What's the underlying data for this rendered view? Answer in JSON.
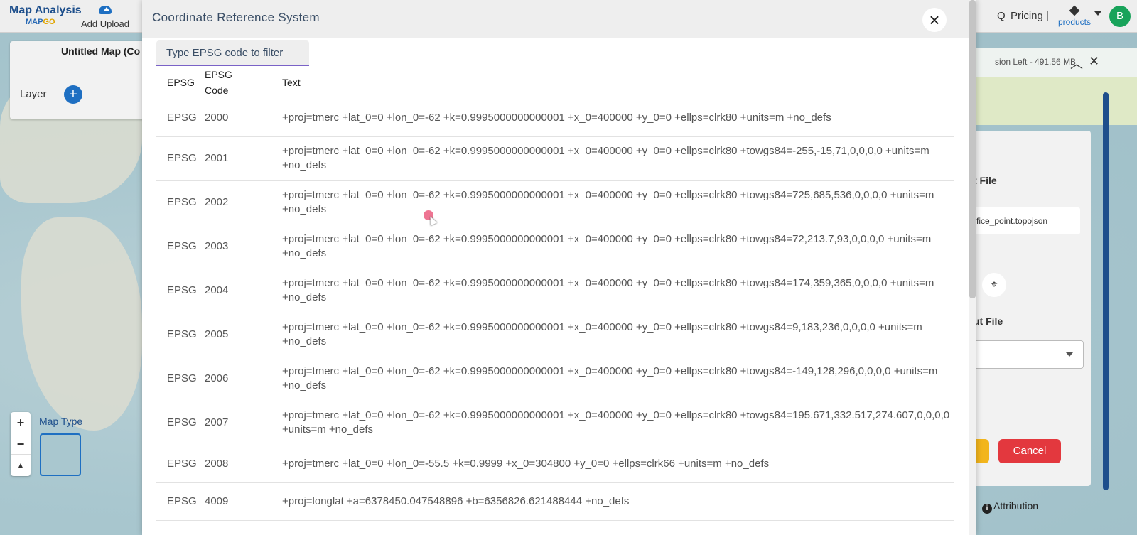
{
  "app": {
    "brand": "Map Analysis",
    "brand_sub_1": "MAP",
    "brand_sub_2": "GO",
    "add_upload": "Add Upload",
    "search_fragment": "Q",
    "pricing": "Pricing |",
    "products": "products",
    "avatar": "B"
  },
  "left_panel": {
    "map_title": "Untitled Map (Co",
    "layer_label": "Layer",
    "map_type_label": "Map Type"
  },
  "right_panel": {
    "session_text": "sion Left - 491.56 MB",
    "input_label": "t File",
    "file_name": "fice_point.topojson",
    "output_label": "ut File",
    "cancel": "Cancel",
    "attribution": "Attribution"
  },
  "modal": {
    "title": "Coordinate Reference System",
    "filter_placeholder": "Type EPSG code to filter",
    "columns": [
      "EPSG",
      "EPSG Code",
      "Text"
    ],
    "rows": [
      {
        "epsg": "EPSG",
        "code": "2000",
        "text": "+proj=tmerc +lat_0=0 +lon_0=-62 +k=0.9995000000000001 +x_0=400000 +y_0=0 +ellps=clrk80 +units=m +no_defs"
      },
      {
        "epsg": "EPSG",
        "code": "2001",
        "text": "+proj=tmerc +lat_0=0 +lon_0=-62 +k=0.9995000000000001 +x_0=400000 +y_0=0 +ellps=clrk80 +towgs84=-255,-15,71,0,0,0,0 +units=m +no_defs"
      },
      {
        "epsg": "EPSG",
        "code": "2002",
        "text": "+proj=tmerc +lat_0=0 +lon_0=-62 +k=0.9995000000000001 +x_0=400000 +y_0=0 +ellps=clrk80 +towgs84=725,685,536,0,0,0,0 +units=m +no_defs"
      },
      {
        "epsg": "EPSG",
        "code": "2003",
        "text": "+proj=tmerc +lat_0=0 +lon_0=-62 +k=0.9995000000000001 +x_0=400000 +y_0=0 +ellps=clrk80 +towgs84=72,213.7,93,0,0,0,0 +units=m +no_defs"
      },
      {
        "epsg": "EPSG",
        "code": "2004",
        "text": "+proj=tmerc +lat_0=0 +lon_0=-62 +k=0.9995000000000001 +x_0=400000 +y_0=0 +ellps=clrk80 +towgs84=174,359,365,0,0,0,0 +units=m +no_defs"
      },
      {
        "epsg": "EPSG",
        "code": "2005",
        "text": "+proj=tmerc +lat_0=0 +lon_0=-62 +k=0.9995000000000001 +x_0=400000 +y_0=0 +ellps=clrk80 +towgs84=9,183,236,0,0,0,0 +units=m +no_defs"
      },
      {
        "epsg": "EPSG",
        "code": "2006",
        "text": "+proj=tmerc +lat_0=0 +lon_0=-62 +k=0.9995000000000001 +x_0=400000 +y_0=0 +ellps=clrk80 +towgs84=-149,128,296,0,0,0,0 +units=m +no_defs"
      },
      {
        "epsg": "EPSG",
        "code": "2007",
        "text": "+proj=tmerc +lat_0=0 +lon_0=-62 +k=0.9995000000000001 +x_0=400000 +y_0=0 +ellps=clrk80 +towgs84=195.671,332.517,274.607,0,0,0,0 +units=m +no_defs"
      },
      {
        "epsg": "EPSG",
        "code": "2008",
        "text": "+proj=tmerc +lat_0=0 +lon_0=-55.5 +k=0.9999 +x_0=304800 +y_0=0 +ellps=clrk66 +units=m +no_defs"
      },
      {
        "epsg": "EPSG",
        "code": "4009",
        "text": "+proj=longlat +a=6378450.047548896 +b=6356826.621488444 +no_defs"
      }
    ]
  },
  "colors": {
    "brand_blue": "#1e4f8c",
    "accent_purple": "#7a62c7",
    "cancel_red": "#e3383e",
    "avatar_green": "#18a35a"
  }
}
